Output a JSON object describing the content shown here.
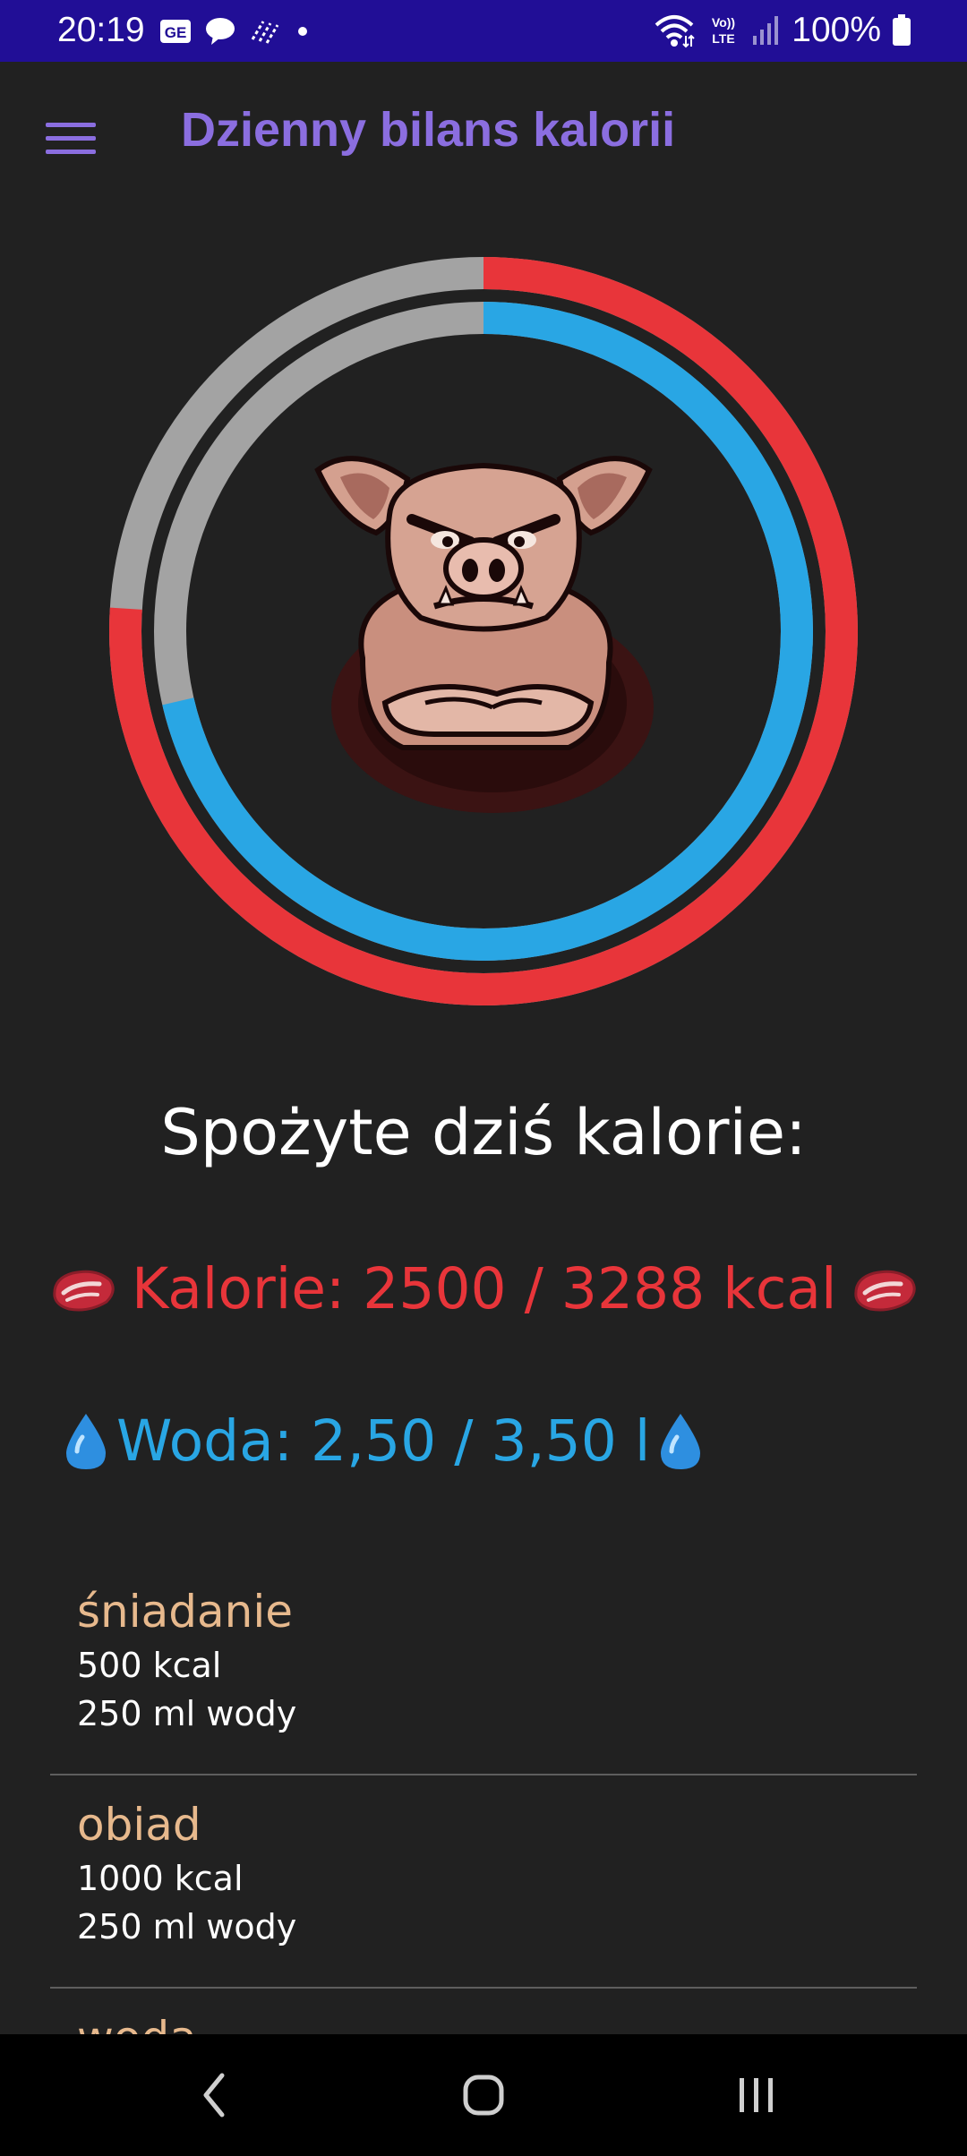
{
  "status_bar": {
    "time": "20:19",
    "battery": "100%",
    "left_icons": [
      "ge-notification-icon",
      "chat-bubble-icon",
      "data-saver-icon",
      "dot-icon"
    ],
    "right_icons": [
      "wifi-icon",
      "volte-icon",
      "signal-icon",
      "battery-icon"
    ],
    "volte_label_top": "Vo))",
    "volte_label_bottom": "LTE",
    "ge_label": "GE"
  },
  "app_bar": {
    "title": "Dzienny bilans kalorii",
    "menu_icon": "hamburger-menu-icon"
  },
  "progress": {
    "calories_fraction": 0.76,
    "water_fraction": 0.714,
    "calories_color": "#e8353a",
    "water_color": "#29a6e4",
    "track_color": "#a3a3a3",
    "mascot_icon": "angry-pig-mascot"
  },
  "summary": {
    "heading": "Spożyte dziś kalorie:",
    "calories_text": "Kalorie: 2500 / 3288 kcal",
    "water_text": "Woda: 2,50 / 3,50 l",
    "calories_icon": "meat-emoji-icon",
    "water_icon": "water-drop-emoji-icon"
  },
  "meals": [
    {
      "name": "śniadanie",
      "kcal": "500 kcal",
      "water": "250 ml wody"
    },
    {
      "name": "obiad",
      "kcal": "1000 kcal",
      "water": "250 ml wody"
    },
    {
      "name": "woda",
      "kcal": "",
      "water": ""
    }
  ],
  "nav_bar": {
    "buttons": [
      "back-icon",
      "home-icon",
      "recents-icon"
    ]
  },
  "colors": {
    "status_bar_bg": "#210e96",
    "background": "#212121",
    "title": "#8b6ee0",
    "meal_name": "#e7b98d"
  }
}
